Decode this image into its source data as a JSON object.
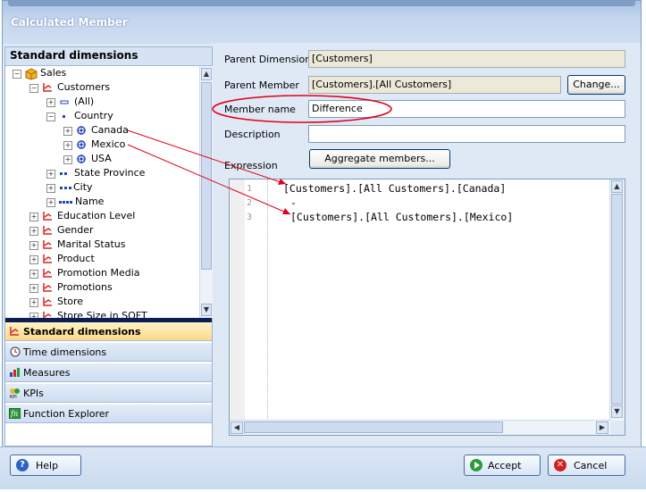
{
  "window": {
    "title": "Calculated Member"
  },
  "left_panel": {
    "header": "Standard dimensions",
    "tree": [
      {
        "label": "Sales",
        "level": 0,
        "expander": "minus",
        "icon": "cube-icon"
      },
      {
        "label": "Customers",
        "level": 1,
        "expander": "minus",
        "icon": "dimension-icon"
      },
      {
        "label": "(All)",
        "level": 2,
        "expander": "plus",
        "icon": "all-level-icon"
      },
      {
        "label": "Country",
        "level": 2,
        "expander": "minus",
        "icon": "level1-icon"
      },
      {
        "label": "Canada",
        "level": 3,
        "expander": "plus",
        "icon": "member-icon"
      },
      {
        "label": "Mexico",
        "level": 3,
        "expander": "plus",
        "icon": "member-icon"
      },
      {
        "label": "USA",
        "level": 3,
        "expander": "plus",
        "icon": "member-icon"
      },
      {
        "label": "State Province",
        "level": 2,
        "expander": "plus",
        "icon": "level2-icon"
      },
      {
        "label": "City",
        "level": 2,
        "expander": "plus",
        "icon": "level3-icon"
      },
      {
        "label": "Name",
        "level": 2,
        "expander": "plus",
        "icon": "level4-icon"
      },
      {
        "label": "Education Level",
        "level": 1,
        "expander": "plus",
        "icon": "dimension-icon"
      },
      {
        "label": "Gender",
        "level": 1,
        "expander": "plus",
        "icon": "dimension-icon"
      },
      {
        "label": "Marital Status",
        "level": 1,
        "expander": "plus",
        "icon": "dimension-icon"
      },
      {
        "label": "Product",
        "level": 1,
        "expander": "plus",
        "icon": "dimension-icon"
      },
      {
        "label": "Promotion Media",
        "level": 1,
        "expander": "plus",
        "icon": "dimension-icon"
      },
      {
        "label": "Promotions",
        "level": 1,
        "expander": "plus",
        "icon": "dimension-icon"
      },
      {
        "label": "Store",
        "level": 1,
        "expander": "plus",
        "icon": "dimension-icon"
      },
      {
        "label": "Store Size in SQFT",
        "level": 1,
        "expander": "plus",
        "icon": "dimension-icon"
      }
    ],
    "nav": [
      {
        "label": "Standard dimensions",
        "icon": "dimension-icon",
        "active": true
      },
      {
        "label": "Time dimensions",
        "icon": "clock-icon",
        "active": false
      },
      {
        "label": "Measures",
        "icon": "measures-icon",
        "active": false
      },
      {
        "label": "KPIs",
        "icon": "kpi-icon",
        "active": false
      },
      {
        "label": "Function Explorer",
        "icon": "function-icon",
        "active": false
      }
    ]
  },
  "form": {
    "parent_dimension_label": "Parent Dimension",
    "parent_dimension_value": "[Customers]",
    "parent_member_label": "Parent Member",
    "parent_member_value": "[Customers].[All Customers]",
    "change_button": "Change...",
    "member_name_label": "Member name",
    "member_name_value": "Difference",
    "description_label": "Description",
    "description_value": "",
    "expression_label": "Expression",
    "aggregate_button": "Aggregate members...",
    "expression_lines": [
      {
        "number": "1",
        "text": "[Customers].[All Customers].[Canada]"
      },
      {
        "number": "2",
        "text": "-"
      },
      {
        "number": "3",
        "text": "[Customers].[All Customers].[Mexico]"
      }
    ]
  },
  "footer": {
    "help_button": "Help",
    "accept_button": "Accept",
    "cancel_button": "Cancel"
  },
  "colors": {
    "annotation": "#e0001a",
    "accent": "#fcd98a"
  }
}
